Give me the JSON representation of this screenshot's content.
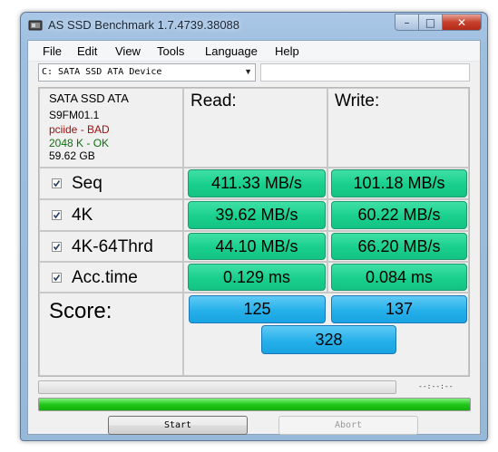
{
  "window": {
    "title": "AS SSD Benchmark 1.7.4739.38088",
    "controls": {
      "minimize": "–",
      "maximize": "□",
      "close": "✕"
    }
  },
  "menu": [
    "File",
    "Edit",
    "View",
    "Tools",
    "Language",
    "Help"
  ],
  "drive": {
    "selected": "C: SATA SSD ATA Device",
    "extra_field": ""
  },
  "info": {
    "model": "SATA SSD ATA",
    "firmware": "S9FM01.1",
    "driver": "pciide - BAD",
    "alignment": "2048 K - OK",
    "size": "59.62 GB"
  },
  "colors": {
    "bad": "#a01010",
    "ok": "#107010",
    "value_bg": "#19cf8d",
    "score_bg": "#26b0ea",
    "progress": "#22c81b"
  },
  "headers": {
    "read": "Read:",
    "write": "Write:"
  },
  "rows": [
    {
      "label": "Seq",
      "checked": true,
      "read": "411.33 MB/s",
      "write": "101.18 MB/s"
    },
    {
      "label": "4K",
      "checked": true,
      "read": "39.62 MB/s",
      "write": "60.22 MB/s"
    },
    {
      "label": "4K-64Thrd",
      "checked": true,
      "read": "44.10 MB/s",
      "write": "66.20 MB/s"
    },
    {
      "label": "Acc.time",
      "checked": true,
      "read": "0.129 ms",
      "write": "0.084 ms"
    }
  ],
  "score": {
    "label": "Score:",
    "read": "125",
    "write": "137",
    "total": "328"
  },
  "progress": {
    "current": 0,
    "total_fill": 1,
    "timer": "--:--:--"
  },
  "buttons": {
    "start": "Start",
    "abort": "Abort"
  }
}
